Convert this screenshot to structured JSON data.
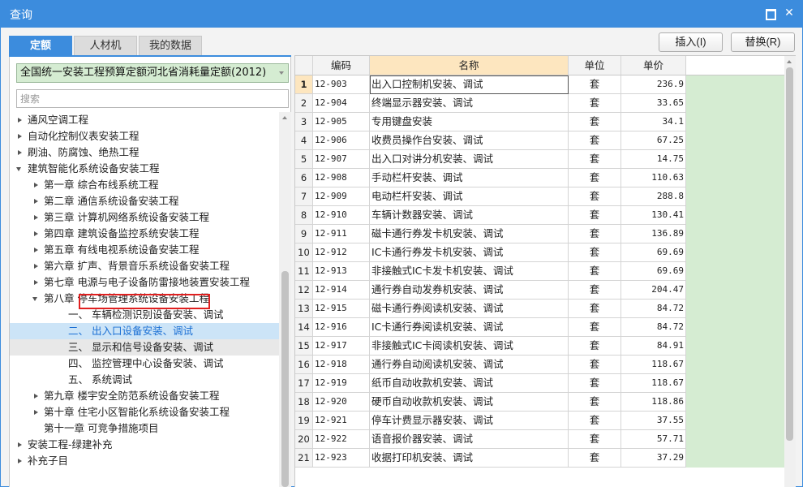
{
  "window": {
    "title": "查询",
    "maximize_icon": "maximize-icon",
    "close_icon": "close-icon",
    "close_glyph": "✕"
  },
  "tabs": [
    {
      "label": "定额",
      "active": true
    },
    {
      "label": "人材机",
      "active": false
    },
    {
      "label": "我的数据",
      "active": false
    }
  ],
  "toolbar": {
    "insert_label": "插入(I)",
    "replace_label": "替换(R)"
  },
  "left": {
    "quota_library": "全国统一安装工程预算定额河北省消耗量定额(2012)",
    "search_placeholder": "搜索",
    "tree": [
      {
        "label": "通风空调工程",
        "level": 0,
        "state": "closed"
      },
      {
        "label": "自动化控制仪表安装工程",
        "level": 0,
        "state": "closed"
      },
      {
        "label": "刷油、防腐蚀、绝热工程",
        "level": 0,
        "state": "closed"
      },
      {
        "label": "建筑智能化系统设备安装工程",
        "level": 0,
        "state": "open"
      },
      {
        "label": "第一章 综合布线系统工程",
        "level": 1,
        "state": "closed"
      },
      {
        "label": "第二章 通信系统设备安装工程",
        "level": 1,
        "state": "closed"
      },
      {
        "label": "第三章 计算机网络系统设备安装工程",
        "level": 1,
        "state": "closed"
      },
      {
        "label": "第四章 建筑设备监控系统安装工程",
        "level": 1,
        "state": "closed"
      },
      {
        "label": "第五章 有线电视系统设备安装工程",
        "level": 1,
        "state": "closed"
      },
      {
        "label": "第六章 扩声、背景音乐系统设备安装工程",
        "level": 1,
        "state": "closed"
      },
      {
        "label": "第七章 电源与电子设备防雷接地装置安装工程",
        "level": 1,
        "state": "closed"
      },
      {
        "label": "第八章 停车场管理系统设备安装工程",
        "level": 1,
        "state": "open"
      },
      {
        "label": "一、 车辆检测识别设备安装、调试",
        "level": 2,
        "state": "leaf"
      },
      {
        "label": "二、 出入口设备安装、调试",
        "level": 2,
        "state": "leaf",
        "selected": true
      },
      {
        "label": "三、 显示和信号设备安装、调试",
        "level": 2,
        "state": "leaf",
        "hover": true
      },
      {
        "label": "四、 监控管理中心设备安装、调试",
        "level": 2,
        "state": "leaf"
      },
      {
        "label": "五、 系统调试",
        "level": 2,
        "state": "leaf"
      },
      {
        "label": "第九章 楼宇安全防范系统设备安装工程",
        "level": 1,
        "state": "closed"
      },
      {
        "label": "第十章 住宅小区智能化系统设备安装工程",
        "level": 1,
        "state": "closed"
      },
      {
        "label": "第十一章 可竞争措施项目",
        "level": 1,
        "state": "leaf"
      },
      {
        "label": "安装工程-绿建补充",
        "level": 0,
        "state": "closed"
      },
      {
        "label": "补充子目",
        "level": 0,
        "state": "closed"
      }
    ]
  },
  "table": {
    "columns": [
      "",
      "编码",
      "名称",
      "单位",
      "单价",
      ""
    ],
    "rows": [
      {
        "idx": "1",
        "code": "12-903",
        "name": "出入口控制机安装、调试",
        "unit": "套",
        "price": "236.9"
      },
      {
        "idx": "2",
        "code": "12-904",
        "name": "终端显示器安装、调试",
        "unit": "套",
        "price": "33.65"
      },
      {
        "idx": "3",
        "code": "12-905",
        "name": "专用键盘安装",
        "unit": "套",
        "price": "34.1"
      },
      {
        "idx": "4",
        "code": "12-906",
        "name": "收费员操作台安装、调试",
        "unit": "套",
        "price": "67.25"
      },
      {
        "idx": "5",
        "code": "12-907",
        "name": "出入口对讲分机安装、调试",
        "unit": "套",
        "price": "14.75"
      },
      {
        "idx": "6",
        "code": "12-908",
        "name": "手动栏杆安装、调试",
        "unit": "套",
        "price": "110.63"
      },
      {
        "idx": "7",
        "code": "12-909",
        "name": "电动栏杆安装、调试",
        "unit": "套",
        "price": "288.8"
      },
      {
        "idx": "8",
        "code": "12-910",
        "name": "车辆计数器安装、调试",
        "unit": "套",
        "price": "130.41"
      },
      {
        "idx": "9",
        "code": "12-911",
        "name": "磁卡通行券发卡机安装、调试",
        "unit": "套",
        "price": "136.89"
      },
      {
        "idx": "10",
        "code": "12-912",
        "name": "IC卡通行券发卡机安装、调试",
        "unit": "套",
        "price": "69.69"
      },
      {
        "idx": "11",
        "code": "12-913",
        "name": "非接触式IC卡发卡机安装、调试",
        "unit": "套",
        "price": "69.69"
      },
      {
        "idx": "12",
        "code": "12-914",
        "name": "通行券自动发券机安装、调试",
        "unit": "套",
        "price": "204.47"
      },
      {
        "idx": "13",
        "code": "12-915",
        "name": "磁卡通行券阅读机安装、调试",
        "unit": "套",
        "price": "84.72"
      },
      {
        "idx": "14",
        "code": "12-916",
        "name": "IC卡通行券阅读机安装、调试",
        "unit": "套",
        "price": "84.72"
      },
      {
        "idx": "15",
        "code": "12-917",
        "name": "非接触式IC卡阅读机安装、调试",
        "unit": "套",
        "price": "84.91"
      },
      {
        "idx": "16",
        "code": "12-918",
        "name": "通行券自动阅读机安装、调试",
        "unit": "套",
        "price": "118.67"
      },
      {
        "idx": "17",
        "code": "12-919",
        "name": "纸币自动收款机安装、调试",
        "unit": "套",
        "price": "118.67"
      },
      {
        "idx": "18",
        "code": "12-920",
        "name": "硬币自动收款机安装、调试",
        "unit": "套",
        "price": "118.86"
      },
      {
        "idx": "19",
        "code": "12-921",
        "name": "停车计费显示器安装、调试",
        "unit": "套",
        "price": "37.55"
      },
      {
        "idx": "20",
        "code": "12-922",
        "name": "语音报价器安装、调试",
        "unit": "套",
        "price": "57.71"
      },
      {
        "idx": "21",
        "code": "12-923",
        "name": "收据打印机安装、调试",
        "unit": "套",
        "price": "37.29"
      }
    ],
    "current_row": 0
  },
  "colors": {
    "accent": "#3c8cdd",
    "name_header": "#fde6bf",
    "green_fill": "#d5ecd2",
    "selection": "#cce4f7",
    "annotation_red": "#e02020"
  }
}
